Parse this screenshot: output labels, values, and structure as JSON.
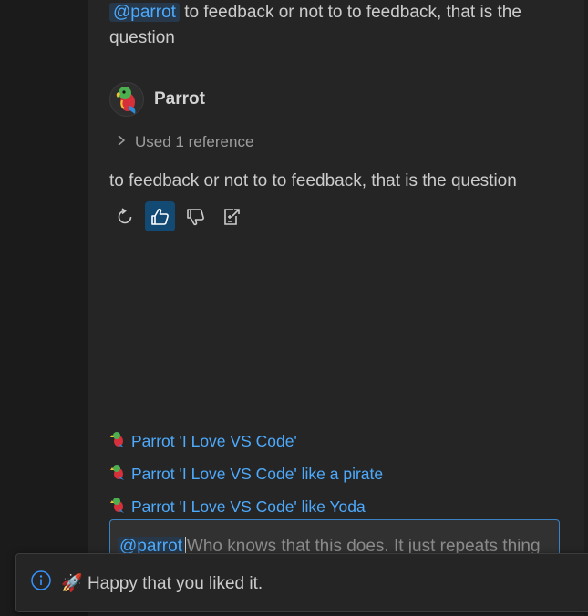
{
  "user_message": {
    "mention": "@parrot",
    "text": " to feedback or not to to feedback, that is the question"
  },
  "bot": {
    "name": "Parrot",
    "avatar_icon": "parrot-icon",
    "references_label": "Used 1 reference",
    "reply": "to feedback or not to to feedback, that is the question"
  },
  "actions": [
    {
      "name": "retry-button",
      "icon": "refresh-icon"
    },
    {
      "name": "thumbs-up-button",
      "icon": "thumbs-up-icon",
      "active": true
    },
    {
      "name": "thumbs-down-button",
      "icon": "thumbs-down-icon"
    },
    {
      "name": "insert-button",
      "icon": "insert-icon"
    }
  ],
  "followups": [
    {
      "label": "Parrot 'I Love VS Code'"
    },
    {
      "label": "Parrot 'I Love VS Code' like a pirate"
    },
    {
      "label": "Parrot 'I Love VS Code' like Yoda"
    }
  ],
  "input": {
    "mention": "@parrot",
    "placeholder": "Who knows that this does. It just repeats thing"
  },
  "toast": {
    "icon": "info-icon",
    "emoji": "🚀",
    "text": "Happy that you liked it."
  },
  "colors": {
    "accent": "#4daafc",
    "active_button": "#124a73",
    "background": "#252526"
  }
}
